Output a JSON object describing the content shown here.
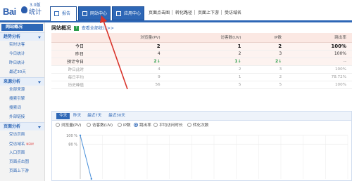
{
  "brand": {
    "name": "Bai",
    "product": "统计",
    "version": "3.0版"
  },
  "top_tabs": [
    {
      "label": "报告",
      "active": true
    },
    {
      "label": "网站中心",
      "active": false
    },
    {
      "label": "应用中心",
      "active": false
    }
  ],
  "top_links": [
    "页面点击图",
    "转化路径",
    "页面上下游",
    "受访域名"
  ],
  "sidebar": {
    "title": "网站概况",
    "sections": [
      {
        "label": "趋势分析",
        "items": [
          "实时访客",
          "今日统计",
          "昨日统计",
          "最近30天"
        ]
      },
      {
        "label": "来源分析",
        "items": [
          "全部来源",
          "搜索引擎",
          "搜索词",
          "外部链接"
        ]
      },
      {
        "label": "页面分析",
        "items": [
          "受访页面",
          "受访域名",
          "入口页面",
          "页面点击图",
          "页面上下游"
        ]
      }
    ],
    "new_badge": "NEW!"
  },
  "page": {
    "title": "网站概况",
    "help_icon": "?",
    "help_link": "查看全部统计>>"
  },
  "stats": {
    "columns": [
      "浏览量(PV)",
      "访客数(UV)",
      "IP数",
      "跳出率"
    ],
    "rows": [
      {
        "label": "今日",
        "values": [
          "2",
          "1",
          "2",
          "100%"
        ]
      },
      {
        "label": "昨日",
        "values": [
          "4",
          "2",
          "3",
          "100%"
        ]
      },
      {
        "label": "预计今日",
        "values": [
          "2",
          "1",
          "2",
          "--"
        ]
      },
      {
        "label": "昨日此时",
        "values": [
          "4",
          "2",
          "3",
          "100%"
        ]
      },
      {
        "label": "每日平均",
        "values": [
          "9",
          "1",
          "2",
          "78.72%"
        ]
      },
      {
        "label": "历史峰值",
        "values": [
          "56",
          "5",
          "5",
          "100%"
        ]
      }
    ],
    "down_arrow": "↓"
  },
  "ranges": [
    "今天",
    "昨天",
    "最近7天",
    "最近30天"
  ],
  "metrics": [
    {
      "label": "浏览量(PV)",
      "selected": false
    },
    {
      "label": "访客数(UV)",
      "selected": false
    },
    {
      "label": "IP数",
      "selected": false
    },
    {
      "label": "跳出率",
      "selected": true
    },
    {
      "label": "平均访问时长",
      "selected": false
    },
    {
      "label": "转化次数",
      "selected": false
    }
  ],
  "chart_data": {
    "type": "line",
    "ylabel": "",
    "y_ticks": [
      "100 %",
      "80 %"
    ],
    "series": [
      {
        "values": [
          100,
          0
        ]
      }
    ],
    "color": "#4a90d9"
  },
  "colors": {
    "brand_blue": "#2e67b6",
    "header_pink": "#fbe8e3",
    "down_green": "#2a9d4a",
    "annotation_red": "#d9342b"
  }
}
